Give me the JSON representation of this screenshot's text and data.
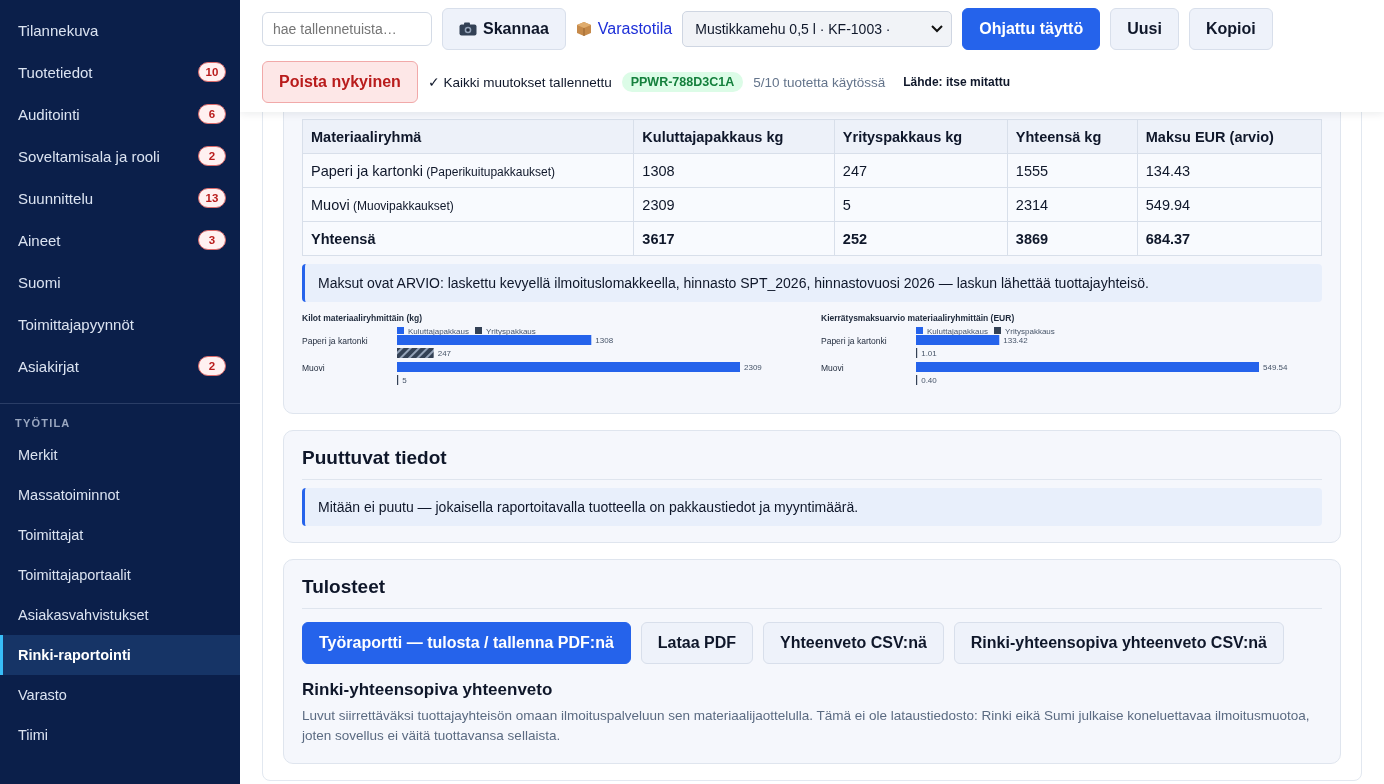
{
  "sidebar": {
    "items": [
      {
        "label": "Tilannekuva",
        "selected": false
      },
      {
        "label": "Tuotetiedot",
        "badge": "10",
        "selected": false
      },
      {
        "label": "Auditointi",
        "badge": "6",
        "selected": false
      },
      {
        "label": "Soveltamisala ja rooli",
        "badge": "2",
        "selected": false
      },
      {
        "label": "Suunnittelu",
        "badge": "13",
        "selected": false
      },
      {
        "label": "Aineet",
        "badge": "3",
        "selected": false
      },
      {
        "label": "Suomi",
        "selected": false
      },
      {
        "label": "Toimittajapyynnöt",
        "selected": false
      },
      {
        "label": "Asiakirjat",
        "badge": "2",
        "selected": false
      }
    ],
    "section_title": "TYÖTILA",
    "workspace_items": [
      {
        "label": "Merkit",
        "selected": false
      },
      {
        "label": "Massatoiminnot",
        "selected": false
      },
      {
        "label": "Toimittajat",
        "selected": false
      },
      {
        "label": "Toimittajaportaalit",
        "selected": false
      },
      {
        "label": "Asiakasvahvistukset",
        "selected": false
      },
      {
        "label": "Rinki-raportointi",
        "selected": true
      },
      {
        "label": "Varasto",
        "selected": false
      },
      {
        "label": "Tiimi",
        "selected": false
      }
    ]
  },
  "toolbar": {
    "search": {
      "placeholder": "hae tallennetuista…"
    },
    "scan_button": "Skannaa",
    "inventory_link": "Varastotila",
    "product_select": "Mustikkamehu 0,5 l · KF-1003 ·",
    "guided_button": "Ohjattu täyttö",
    "new_button": "Uusi",
    "copy_button": "Kopioi",
    "delete_button": "Poista nykyinen",
    "save_status": "✓ Kaikki muutokset tallennettu",
    "product_id": "PPWR-788D3C1A",
    "usage": "5/10 tuotetta käytössä",
    "source": "Lähde: itse mitattu"
  },
  "summary_table": {
    "columns": [
      "Materiaaliryhmä",
      "Kuluttajapakkaus kg",
      "Yrityspakkaus kg",
      "Yhteensä kg",
      "Maksu EUR (arvio)"
    ],
    "rows": [
      {
        "note": "(Paperikuitupakkaukset)",
        "cells": [
          "Paperi ja kartonki",
          "1308",
          "247",
          "1555",
          "134.43"
        ]
      },
      {
        "note": "(Muovipakkaukset)",
        "cells": [
          "Muovi",
          "2309",
          "5",
          "2314",
          "549.94"
        ]
      },
      {
        "kind": "total",
        "cells": [
          "Yhteensä",
          "3617",
          "252",
          "3869",
          "684.37"
        ]
      }
    ],
    "note": "Maksut ovat ARVIO: laskettu kevyellä ilmoituslomakkeella, hinnasto SPT_2026, hinnastovuosi 2026 — laskun lähettää tuottajayhteisö.",
    "charts": [
      {
        "chart_data": {
          "type": "bar",
          "orientation": "horizontal",
          "legend": "top",
          "title": "Kilot materiaaliryhmittäin (kg)",
          "categories": [
            "Paperi ja kartonki",
            "Muovi"
          ],
          "series": [
            {
              "name": "Kuluttajapakkaus",
              "color": "#2563eb",
              "values": [
                1308,
                2309
              ],
              "value_labels": [
                "1308",
                "2309"
              ]
            },
            {
              "name": "Yrityspakkaus",
              "color": "#334155",
              "values": [
                247,
                5
              ],
              "value_labels": [
                "247",
                "5"
              ]
            }
          ]
        }
      },
      {
        "chart_data": {
          "type": "bar",
          "orientation": "horizontal",
          "legend": "top",
          "title": "Kierrätysmaksuarvio materiaaliryhmittäin (EUR)",
          "categories": [
            "Paperi ja kartonki",
            "Muovi"
          ],
          "series": [
            {
              "name": "Kuluttajapakkaus",
              "color": "#2563eb",
              "values": [
                133.42,
                549.54
              ],
              "value_labels": [
                "133.42",
                "549.54"
              ]
            },
            {
              "name": "Yrityspakkaus",
              "color": "#334155",
              "values": [
                1.01,
                0.4
              ],
              "value_labels": [
                "1.01",
                "0.40"
              ]
            }
          ]
        }
      }
    ]
  },
  "missing": {
    "title": "Puuttuvat tiedot",
    "note": "Mitään ei puutu — jokaisella raportoitavalla tuotteella on pakkaustiedot ja myyntimäärä."
  },
  "outputs": {
    "title": "Tulosteet",
    "buttons": [
      {
        "label": "Työraportti — tulosta / tallenna PDF:nä",
        "kind": "primary"
      },
      {
        "label": "Lataa PDF",
        "kind": "secondary"
      },
      {
        "label": "Yhteenveto CSV:nä",
        "kind": "secondary"
      },
      {
        "label": "Rinki-yhteensopiva yhteenveto CSV:nä",
        "kind": "secondary"
      }
    ],
    "subtitle": "Rinki-yhteensopiva yhteenveto",
    "text": "Luvut siirrettäväksi tuottajayhteisön omaan ilmoituspalveluun sen materiaalijaottelulla. Tämä ei ole lataustiedosto: Rinki eikä Sumi julkaise koneluettavaa ilmoitusmuotoa, joten sovellus ei väitä tuottavansa sellaista."
  }
}
